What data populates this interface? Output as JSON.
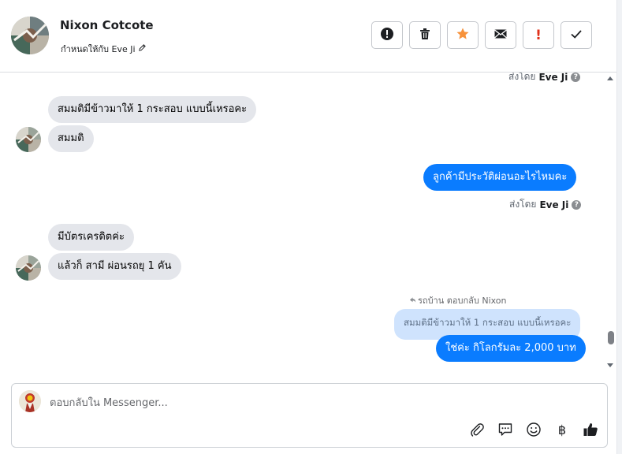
{
  "header": {
    "contact_name": "Nixon Cotcote",
    "assigned_to": "กำหนดให้กับ Eve Ji",
    "actions": [
      {
        "name": "report-spam",
        "icon": "alert-circle-icon"
      },
      {
        "name": "delete",
        "icon": "trash-icon"
      },
      {
        "name": "star",
        "icon": "star-icon",
        "color": "#f7923b"
      },
      {
        "name": "mark-unread",
        "icon": "envelope-icon"
      },
      {
        "name": "flag-urgent",
        "icon": "exclamation-icon",
        "color": "#e0321b"
      },
      {
        "name": "mark-done",
        "icon": "check-icon"
      }
    ]
  },
  "messages": {
    "top_sent_by": {
      "prefix": "ส่งโดย",
      "agent": "Eve Ji"
    },
    "incoming_1": "สมมติมีข้าวมาให้ 1 กระสอบ แบบนี้เหรอคะ",
    "incoming_2": "สมมติ",
    "outgoing_1": "ลูกค้ามีประวัติผ่อนอะไรไหมคะ",
    "sent_by_1": {
      "prefix": "ส่งโดย",
      "agent": "Eve Ji"
    },
    "incoming_3": "มีบัตรเครดิตค่ะ",
    "incoming_4": "แล้วก็ สามี ผ่อนรถยุ 1 คัน",
    "reply_note": "รถบ้าน ตอบกลับ Nixon",
    "quoted": "สมมติมีข้าวมาให้ 1 กระสอบ แบบนี้เหรอคะ",
    "outgoing_2": "ใช่ค่ะ กิโลกรัมละ 2,000 บาท"
  },
  "composer": {
    "placeholder": "ตอบกลับใน Messenger...",
    "tools": [
      {
        "name": "attach",
        "icon": "paperclip-icon"
      },
      {
        "name": "saved-replies",
        "icon": "chat-bubble-icon"
      },
      {
        "name": "emoji",
        "icon": "smiley-icon"
      },
      {
        "name": "payment",
        "icon": "baht-icon",
        "glyph": "฿"
      },
      {
        "name": "like",
        "icon": "thumbs-up-icon"
      }
    ]
  },
  "colors": {
    "accent": "#0a7cff",
    "incoming_bubble": "#e4e6eb",
    "quoted_bubble": "#cfe3fd",
    "star": "#f7923b",
    "urgent": "#e0321b"
  }
}
